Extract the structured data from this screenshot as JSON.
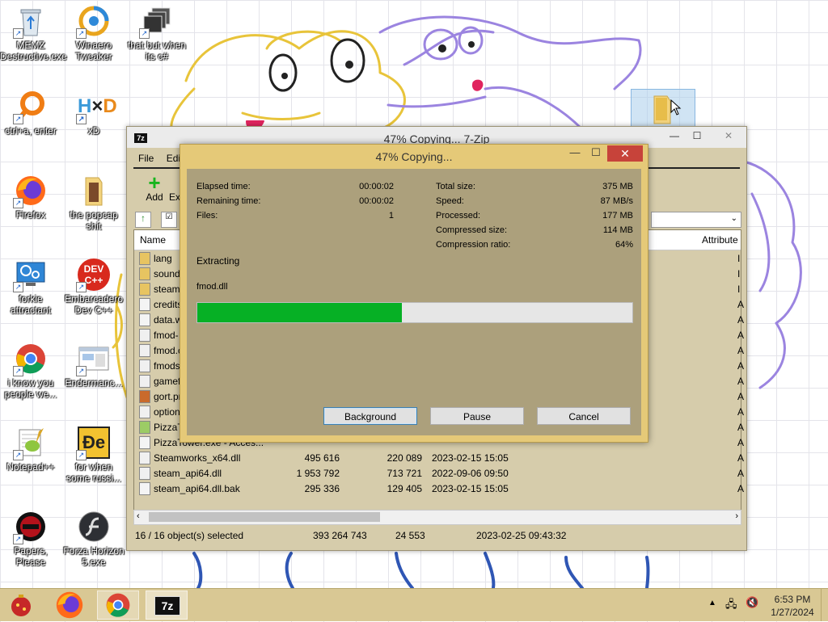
{
  "desktop": {
    "icons": [
      {
        "label": "MEMZ Destructive.exe"
      },
      {
        "label": "Winaero Tweaker"
      },
      {
        "label": "that but when its c#"
      },
      {
        "label": "ctrl+a, enter"
      },
      {
        "label": "xD"
      },
      {
        "label": "Firefox"
      },
      {
        "label": "the popcap shit"
      },
      {
        "label": "forkie attractant"
      },
      {
        "label": "Embarcadero Dev C++"
      },
      {
        "label": "i know you people we..."
      },
      {
        "label": "Endermanc..."
      },
      {
        "label": "Notepad++"
      },
      {
        "label": "for when some russi..."
      },
      {
        "label": "Papers, Please"
      },
      {
        "label": "Forza Horizon 5.exe"
      }
    ],
    "hx_text": "H",
    "dev_text": "DEV",
    "dev_sub": "C++"
  },
  "main_window": {
    "title": "47% Copying... 7-Zip",
    "app_icon": "7z",
    "menu": [
      "File",
      "Edit"
    ],
    "toolbar": {
      "add_label": "Add",
      "extract_label": "Ext"
    },
    "columns": {
      "name": "Name",
      "attributes": "Attribute"
    },
    "files": [
      {
        "name": "lang",
        "size": "",
        "packed": "",
        "modified": "",
        "attr": "I",
        "type": "folder"
      },
      {
        "name": "sound",
        "size": "",
        "packed": "",
        "modified": "",
        "attr": "I",
        "type": "folder"
      },
      {
        "name": "steam_",
        "size": "",
        "packed": "",
        "modified": "",
        "attr": "I",
        "type": "folder"
      },
      {
        "name": "credits",
        "size": "",
        "packed": "",
        "modified": "",
        "attr": "A",
        "type": "file"
      },
      {
        "name": "data.w",
        "size": "",
        "packed": "",
        "modified": "",
        "attr": "A",
        "type": "file"
      },
      {
        "name": "fmod-",
        "size": "",
        "packed": "",
        "modified": "",
        "attr": "A",
        "type": "dll"
      },
      {
        "name": "fmod.c",
        "size": "",
        "packed": "",
        "modified": "",
        "attr": "A",
        "type": "dll"
      },
      {
        "name": "fmods",
        "size": "",
        "packed": "",
        "modified": "",
        "attr": "A",
        "type": "dll"
      },
      {
        "name": "gamef",
        "size": "",
        "packed": "",
        "modified": "",
        "attr": "A",
        "type": "dll"
      },
      {
        "name": "gort.pr",
        "size": "",
        "packed": "",
        "modified": "",
        "attr": "A",
        "type": "img"
      },
      {
        "name": "option",
        "size": "",
        "packed": "",
        "modified": "",
        "attr": "A",
        "type": "dll"
      },
      {
        "name": "PizzaT",
        "size": "",
        "packed": "",
        "modified": "",
        "attr": "A",
        "type": "exe"
      },
      {
        "name": "PizzaTower.exe - Acces...",
        "size": "",
        "packed": "",
        "modified": "",
        "attr": "A",
        "type": "file"
      },
      {
        "name": "Steamworks_x64.dll",
        "size": "495 616",
        "packed": "220 089",
        "modified": "2023-02-15 15:05",
        "attr": "A",
        "type": "dll"
      },
      {
        "name": "steam_api64.dll",
        "size": "1 953 792",
        "packed": "713 721",
        "modified": "2022-09-06 09:50",
        "attr": "A",
        "type": "dll"
      },
      {
        "name": "steam_api64.dll.bak",
        "size": "295 336",
        "packed": "129 405",
        "modified": "2023-02-15 15:05",
        "attr": "A",
        "type": "file"
      }
    ],
    "status": {
      "selected": "16 / 16 object(s) selected",
      "size": "393 264 743",
      "packed": "24 553",
      "modified": "2023-02-25 09:43:32"
    }
  },
  "dialog": {
    "title": "47% Copying...",
    "elapsed_label": "Elapsed time:",
    "elapsed_value": "00:00:02",
    "remaining_label": "Remaining time:",
    "remaining_value": "00:00:02",
    "files_label": "Files:",
    "files_value": "1",
    "total_label": "Total size:",
    "total_value": "375 MB",
    "speed_label": "Speed:",
    "speed_value": "87 MB/s",
    "processed_label": "Processed:",
    "processed_value": "177 MB",
    "compressed_label": "Compressed size:",
    "compressed_value": "114 MB",
    "ratio_label": "Compression ratio:",
    "ratio_value": "64%",
    "operation": "Extracting",
    "current_file": "fmod.dll",
    "progress_percent": 47,
    "buttons": {
      "background": "Background",
      "pause": "Pause",
      "cancel": "Cancel"
    }
  },
  "taskbar": {
    "apps": [
      "ornament-icon",
      "firefox-icon",
      "chrome-icon",
      "7zip-icon"
    ],
    "active_app": "7z",
    "clock_time": "6:53 PM",
    "clock_date": "1/27/2024"
  },
  "colors": {
    "dialog_frame": "#e5c978",
    "dialog_body": "#aca07c",
    "progress_fill": "#06b025",
    "taskbar": "#d9c894",
    "close_button": "#c7433a"
  }
}
